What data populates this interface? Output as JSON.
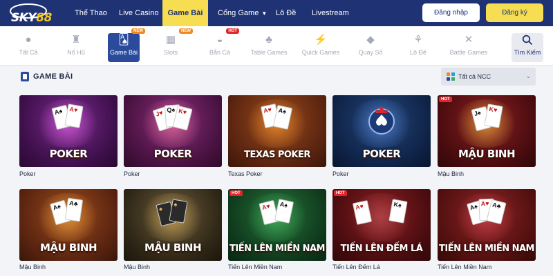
{
  "brand": {
    "logo_text_a": "SKY",
    "logo_text_b": "88",
    "accent": "#f6dd52",
    "primary": "#1f3374"
  },
  "nav": {
    "items": [
      {
        "label": "Thể Thao"
      },
      {
        "label": "Live Casino"
      },
      {
        "label": "Game Bài"
      },
      {
        "label": "Cổng Game"
      },
      {
        "label": "Lô Đề"
      },
      {
        "label": "Livestream"
      }
    ],
    "active": "Game Bài",
    "login_label": "Đăng nhập",
    "register_label": "Đăng ký"
  },
  "categories": [
    {
      "label": "Tất Cả",
      "icon": "poker-chip-icon"
    },
    {
      "label": "Nổ Hũ",
      "icon": "jackpot-icon"
    },
    {
      "label": "Game Bài",
      "icon": "cards-icon",
      "badge": "NEW"
    },
    {
      "label": "Slots",
      "icon": "slots-icon",
      "badge": "NEW"
    },
    {
      "label": "Bắn Cá",
      "icon": "fish-icon",
      "badge": "HOT"
    },
    {
      "label": "Table Games",
      "icon": "table-icon"
    },
    {
      "label": "Quick Games",
      "icon": "lightning-icon"
    },
    {
      "label": "Quay Số",
      "icon": "diamond-icon"
    },
    {
      "label": "Lô Đề",
      "icon": "lottery-icon"
    },
    {
      "label": "Battle Games",
      "icon": "swords-icon"
    },
    {
      "label": "Tìm Kiếm",
      "icon": "search-icon"
    }
  ],
  "section": {
    "title": "GAME BÀI",
    "filter_label": "Tất cả NCC"
  },
  "games": [
    {
      "name": "Poker",
      "art_title": "POKER"
    },
    {
      "name": "Poker",
      "art_title": "POKER"
    },
    {
      "name": "Texas Poker",
      "art_title": "TEXAS POKER"
    },
    {
      "name": "Poker",
      "art_title": "POKER"
    },
    {
      "name": "Mậu Binh",
      "art_title": "MẬU BINH",
      "badge": "HOT"
    },
    {
      "name": "Mậu Binh",
      "art_title": "MẬU BINH"
    },
    {
      "name": "Mậu Binh",
      "art_title": "MẬU BINH"
    },
    {
      "name": "Tiến Lên Miền Nam",
      "art_title": "TIẾN LÊN MIỀN NAM",
      "badge": "HOT"
    },
    {
      "name": "Tiến Lên Đếm Lá",
      "art_title": "TIẾN LÊN ĐẾM LÁ",
      "badge": "HOT"
    },
    {
      "name": "Tiến Lên Miền Nam",
      "art_title": "TIẾN LÊN MIỀN NAM"
    }
  ]
}
